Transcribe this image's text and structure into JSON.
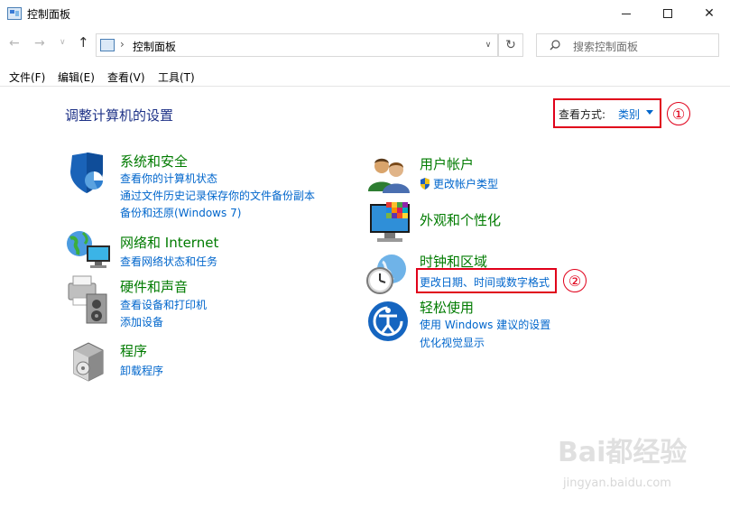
{
  "window": {
    "title": "控制面板",
    "minimize_glyph": "",
    "maximize_glyph": "",
    "close_glyph": "✕"
  },
  "nav": {
    "back_glyph": "←",
    "forward_glyph": "→",
    "recent_glyph": "∨",
    "up_glyph": "↑",
    "breadcrumb_sep": "›",
    "address": "控制面板",
    "dropdown_glyph": "∨",
    "refresh_glyph": "↻",
    "search_placeholder": "搜索控制面板"
  },
  "menu": {
    "items": [
      "文件(F)",
      "编辑(E)",
      "查看(V)",
      "工具(T)"
    ]
  },
  "main": {
    "title": "调整计算机的设置",
    "view_by_label": "查看方式:",
    "view_by_value": "类别",
    "annotation_1": "①",
    "annotation_2": "②"
  },
  "categories": {
    "system": {
      "title": "系统和安全",
      "links": [
        "查看你的计算机状态",
        "通过文件历史记录保存你的文件备份副本",
        "备份和还原(Windows 7)"
      ]
    },
    "network": {
      "title": "网络和 Internet",
      "links": [
        "查看网络状态和任务"
      ]
    },
    "hardware": {
      "title": "硬件和声音",
      "links": [
        "查看设备和打印机",
        "添加设备"
      ]
    },
    "programs": {
      "title": "程序",
      "links": [
        "卸载程序"
      ]
    },
    "users": {
      "title": "用户帐户",
      "links": [
        "更改帐户类型"
      ]
    },
    "appearance": {
      "title": "外观和个性化",
      "links": []
    },
    "clock": {
      "title": "时钟和区域",
      "links": [
        "更改日期、时间或数字格式"
      ]
    },
    "ease": {
      "title": "轻松使用",
      "links": [
        "使用 Windows 建议的设置",
        "优化视觉显示"
      ]
    }
  },
  "watermark": {
    "text": "Bai都经验",
    "sub": "jingyan.baidu.com"
  },
  "colors": {
    "category_title": "#007b00",
    "link": "#0066cc",
    "heading": "#1e3287",
    "highlight": "#e0001a"
  }
}
